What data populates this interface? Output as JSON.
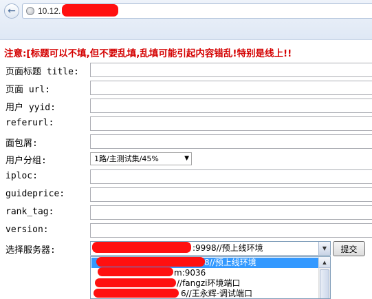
{
  "browser": {
    "url": "10.12."
  },
  "warning": "注意:[标题可以不填,但不要乱填,乱填可能引起内容错乱!特别是线上!!",
  "form": {
    "fields": [
      {
        "label": "页面标题 title:"
      },
      {
        "label": "页面 url:"
      },
      {
        "label": "用户 yyid:"
      },
      {
        "label": "referurl:"
      },
      {
        "label": "面包屑:"
      },
      {
        "label": "用户分组:"
      },
      {
        "label": "iploc:"
      },
      {
        "label": "guideprice:"
      },
      {
        "label": "rank_tag:"
      },
      {
        "label": "version:"
      },
      {
        "label": "选择服务器:"
      }
    ],
    "group_select": {
      "value": "1路/主测试集/45%"
    },
    "server_select": {
      "value": ":9998//预上线环境"
    },
    "submit_label": "提交",
    "server_options": [
      {
        "label": "8//预上线环境",
        "selected": true
      },
      {
        "label": "m:9036",
        "selected": false
      },
      {
        "label": "//fangzi环境端口",
        "selected": false
      },
      {
        "label": "6//王永辉-调试端口",
        "selected": false
      }
    ]
  },
  "colors": {
    "warning": "#d40000",
    "redaction": "#ff1010",
    "selection": "#3399ff"
  }
}
